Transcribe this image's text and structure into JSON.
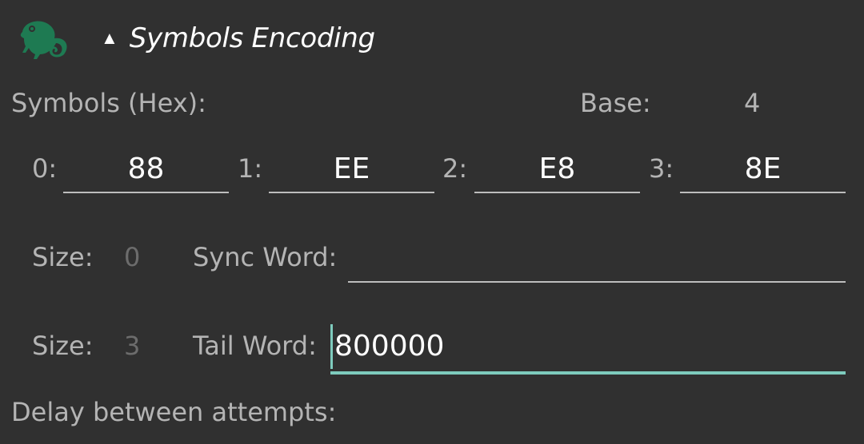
{
  "section": {
    "caret": "▲",
    "title": "Symbols Encoding",
    "logo_icon": "chameleon-logo-icon",
    "logo_color": "#1e7a52"
  },
  "symbols": {
    "label": "Symbols (Hex):",
    "base_label": "Base:",
    "base_value": "4",
    "items": [
      {
        "label": "0:",
        "value": "88"
      },
      {
        "label": "1:",
        "value": "EE"
      },
      {
        "label": "2:",
        "value": "E8"
      },
      {
        "label": "3:",
        "value": "8E"
      }
    ]
  },
  "sync": {
    "size_label": "Size:",
    "size_value": "0",
    "word_label": "Sync Word:",
    "word_value": ""
  },
  "tail": {
    "size_label": "Size:",
    "size_value": "3",
    "word_label": "Tail Word:",
    "word_value": "800000"
  },
  "delay": {
    "label": "Delay between attempts:"
  },
  "colors": {
    "background": "#303030",
    "accent": "#7ecbbd",
    "text": "#ffffff",
    "label": "#b4b4b4",
    "dim": "#6c6c6c"
  }
}
